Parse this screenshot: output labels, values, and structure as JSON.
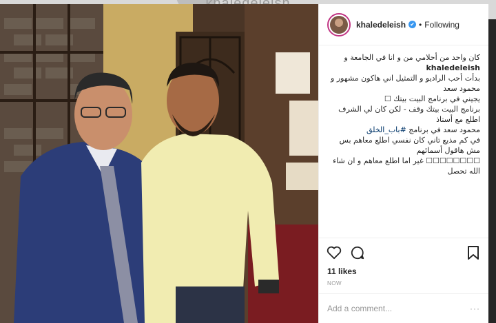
{
  "backdrop": {
    "profile_name": "khaledeleish"
  },
  "header": {
    "username": "khaledeleish",
    "verified_mark": "✔",
    "separator": "•",
    "follow_state": "Following"
  },
  "caption": {
    "author": "khaledeleish",
    "line1": "كان واحد من أحلامي من و انا في الجامعة و",
    "line2": "بدأت أحب الراديو و التمثيل اني هاكون مشهور و محمود سعد",
    "line3": "يجيني في برنامج البيت بيتك ☐",
    "line4": "برنامج البيت بيتك وقف - لكن كان لي الشرف اطلع مع أستاذ",
    "line5a": "محمود سعد في برنامج ",
    "line5_tag": "#باب_الخلق",
    "line6": "في كم مذيع تاني كان نفسي اطلع معاهم بس مش هاقول أسمائهم",
    "line7": "☐☐☐☐☐☐☐☐ غير اما اطلع معاهم و ان شاء الله تحصل"
  },
  "icons": {
    "like": "heart-icon",
    "comment": "speech-bubble-icon",
    "save": "bookmark-icon"
  },
  "likes": "11 likes",
  "timestamp": "NOW",
  "comment_box": {
    "placeholder": "Add a comment...",
    "more": "···"
  }
}
